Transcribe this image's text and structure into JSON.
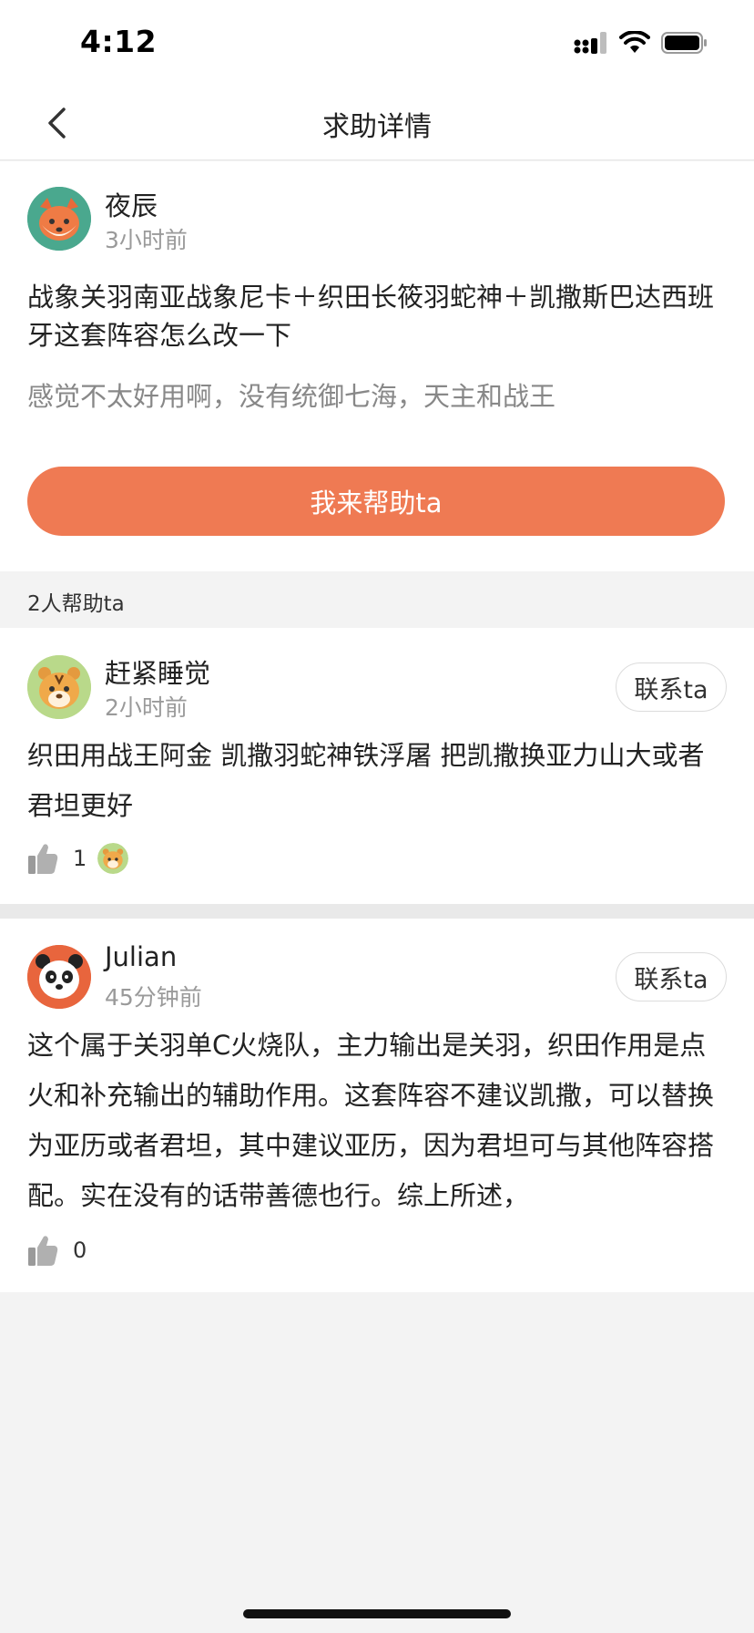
{
  "status_bar": {
    "time": "4:12"
  },
  "nav": {
    "title": "求助详情"
  },
  "question": {
    "author": "夜辰",
    "time": "3小时前",
    "text": "战象关羽南亚战象尼卡＋织田长筱羽蛇神＋凯撒斯巴达西班牙这套阵容怎么改一下",
    "subtext": "感觉不太好用啊，没有统御七海，天主和战王",
    "help_button": "我来帮助ta"
  },
  "helpers_header": "2人帮助ta",
  "answers": [
    {
      "author": "赶紧睡觉",
      "time": "2小时前",
      "contact": "联系ta",
      "text": "织田用战王阿金  凯撒羽蛇神铁浮屠  把凯撒换亚力山大或者君坦更好",
      "likes": "1"
    },
    {
      "author": "Julian",
      "time": "45分钟前",
      "contact": "联系ta",
      "text": "这个属于关羽单C火烧队，主力输出是关羽，织田作用是点火和补充输出的辅助作用。这套阵容不建议凯撒，可以替换为亚历或者君坦，其中建议亚历，因为君坦可与其他阵容搭配。实在没有的话带善德也行。综上所述，",
      "likes": "0"
    }
  ],
  "colors": {
    "accent": "#ef7a53",
    "muted_text": "#9a9a9a",
    "background": "#f3f3f3"
  },
  "icons": {
    "back": "chevron-left-icon",
    "signal": "signal-icon",
    "wifi": "wifi-icon",
    "battery": "battery-icon",
    "like": "thumbs-up-icon"
  }
}
